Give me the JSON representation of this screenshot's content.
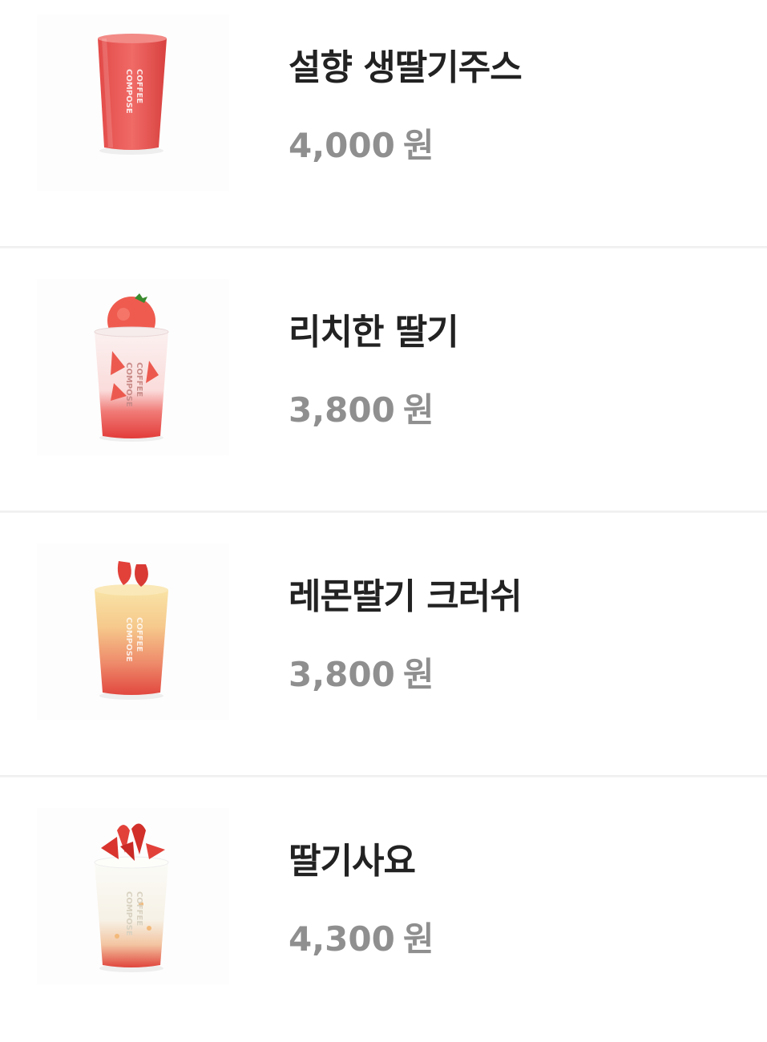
{
  "menu": {
    "items": [
      {
        "name": "설향 생딸기주스",
        "price": "4,000",
        "currency": "원",
        "image_icon": "strawberry-juice-cup-image",
        "cup_print": [
          "COMPOSE",
          "COFFEE"
        ]
      },
      {
        "name": "리치한 딸기",
        "price": "3,800",
        "currency": "원",
        "image_icon": "rich-strawberry-cup-image",
        "cup_print": [
          "COMPOSE",
          "COFFEE"
        ]
      },
      {
        "name": "레몬딸기 크러쉬",
        "price": "3,800",
        "currency": "원",
        "image_icon": "lemon-strawberry-crush-cup-image",
        "cup_print": [
          "COMPOSE",
          "COFFEE"
        ]
      },
      {
        "name": "딸기사요",
        "price": "4,300",
        "currency": "원",
        "image_icon": "strawberry-sayo-cup-image",
        "cup_print": [
          "COMPOSE",
          "COFFEE"
        ]
      }
    ]
  },
  "colors": {
    "name_text": "#222222",
    "price_text": "#8f8f8f",
    "divider": "#ececec",
    "strawberry_red": "#e8433f",
    "lemon_yellow": "#f7d98a"
  }
}
